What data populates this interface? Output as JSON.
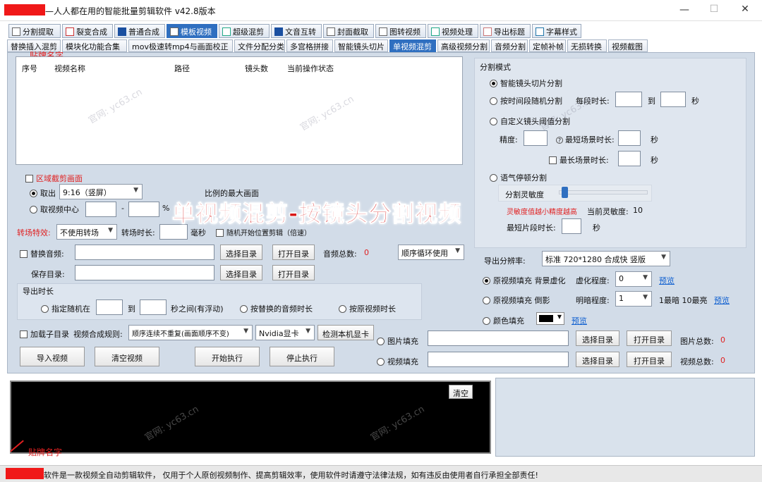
{
  "titlebar": {
    "title": "—人人都在用的智能批量剪辑软件   v42.8版本",
    "minimize": "—",
    "maximize": "☐",
    "close": "✕"
  },
  "annotation": {
    "label": "贴牌名字"
  },
  "tabs_main": [
    {
      "label": "分割提取"
    },
    {
      "label": "裂变合成"
    },
    {
      "label": "普通合成"
    },
    {
      "label": "模板视频"
    },
    {
      "label": "超级混剪"
    },
    {
      "label": "文音互转"
    },
    {
      "label": "封面截取"
    },
    {
      "label": "图转视频"
    },
    {
      "label": "视频处理"
    },
    {
      "label": "导出标题"
    },
    {
      "label": "字幕样式"
    }
  ],
  "tabs_sub": [
    {
      "label": "替换插入混剪"
    },
    {
      "label": "模块化功能合集"
    },
    {
      "label": "mov极速转mp4与画面校正"
    },
    {
      "label": "文件分配分类"
    },
    {
      "label": "多宫格拼接"
    },
    {
      "label": "智能镜头切片"
    },
    {
      "label": "单视频混剪"
    },
    {
      "label": "高级视频分割"
    },
    {
      "label": "音频分割"
    },
    {
      "label": "定帧补帧"
    },
    {
      "label": "无损转换"
    },
    {
      "label": "视频截图"
    }
  ],
  "table": {
    "columns": [
      "序号",
      "视频名称",
      "路径",
      "镜头数",
      "当前操作状态"
    ]
  },
  "region": {
    "checkbox_label": "区域截剪画面",
    "take_label": "取出",
    "ratio_value": "9:16（竖屏）",
    "ratio_hint": "比例的最大画面",
    "center_label": "取视频中心",
    "dash": "-",
    "pct": "%"
  },
  "transition": {
    "label": "转场特效:",
    "effect_value": "不使用转场",
    "duration_label": "转场时长:",
    "duration_unit": "毫秒",
    "random_label": "随机开始位置剪辑（倍速）"
  },
  "audio": {
    "replace_label": "替换音频:",
    "select_btn": "选择目录",
    "open_btn": "打开目录",
    "total_label": "音频总数:",
    "total_value": "0",
    "order_value": "顺序循环使用"
  },
  "save": {
    "label": "保存目录:",
    "select_btn": "选择目录",
    "open_btn": "打开目录"
  },
  "export_duration": {
    "title": "导出时长",
    "random_label": "指定随机在",
    "to": "到",
    "suffix": "秒之间(有浮动)",
    "by_audio": "按替换的音频时长",
    "by_video": "按原视频时长"
  },
  "bottom_row": {
    "subdir_label": "加载子目录",
    "rule_label": "视频合成规则:",
    "rule_value": "顺序连续不重复(画面顺序不变)",
    "gpu_value": "Nvidia显卡",
    "detect_btn": "检测本机显卡"
  },
  "actions": {
    "import": "导入视频",
    "clear": "清空视频",
    "start": "开始执行",
    "stop": "停止执行"
  },
  "split_mode": {
    "title": "分割模式",
    "smart": "智能镜头切片分割",
    "by_time": "按时间段随机分割",
    "segment_label": "每段时长:",
    "to": "到",
    "sec": "秒",
    "custom": "自定义镜头阈值分割",
    "precision": "精度:",
    "min_scene": "最短场景时长:",
    "max_scene": "最长场景时长:",
    "tone": "语气停顿分割",
    "sensitivity_label": "分割灵敏度",
    "sensitivity_value": 0.03,
    "sensitivity_hint": "灵敏度值越小精度越高",
    "current_label": "当前灵敏度:",
    "current_value": "10",
    "min_clip": "最短片段时长:"
  },
  "output": {
    "resolution_label": "导出分辨率:",
    "resolution_value": "标准 720*1280 合成快 竖版",
    "fill_blur": "原视频填充 背景虚化",
    "blur_label": "虚化程度:",
    "blur_value": "0",
    "preview": "预览",
    "fill_shadow": "原视频填充 倒影",
    "bright_label": "明暗程度:",
    "bright_value": "1",
    "bright_hint": "1最暗 10最亮",
    "color_fill": "颜色填充",
    "img_fill": "图片填充",
    "img_select": "选择目录",
    "img_open": "打开目录",
    "img_total_label": "图片总数:",
    "img_total_value": "0",
    "video_fill": "视频填充",
    "video_select": "选择目录",
    "video_open": "打开目录",
    "video_total_label": "视频总数:",
    "video_total_value": "0"
  },
  "overlay": {
    "text": "单视频混剪-按镜头分割视频"
  },
  "log": {
    "clear_btn": "清空"
  },
  "watermark": {
    "text": "官网: yc63.cn"
  },
  "status": {
    "text": "软件是一款视频全自动剪辑软件，  仅用于个人原创视频制作、提高剪辑效率，使用软件时请遵守法律法规，如有违反由使用者自行承担全部责任!"
  }
}
